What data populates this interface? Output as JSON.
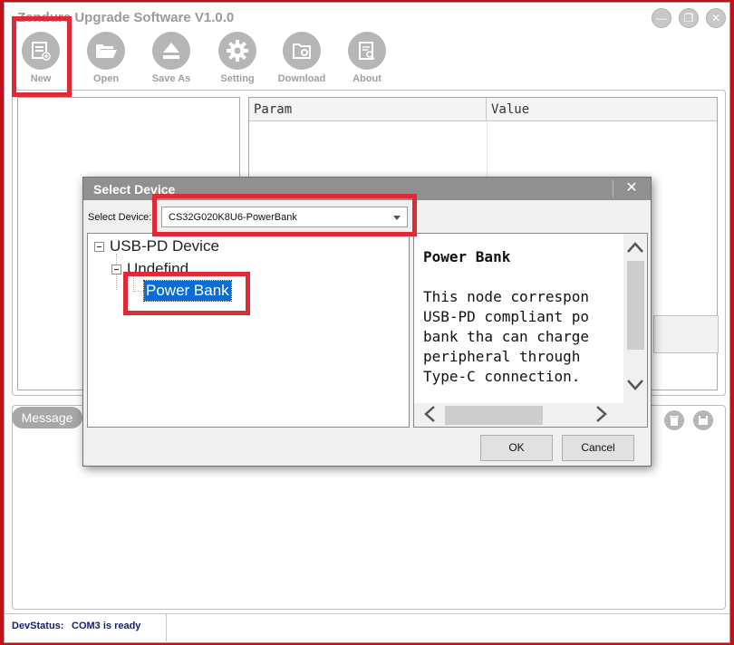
{
  "app": {
    "title": "Zendure Upgrade Software V1.0.0",
    "window_buttons": {
      "minimize": "—",
      "restore": "❐",
      "close": "✕"
    }
  },
  "toolbar": [
    {
      "label": "New",
      "icon": "new-document-icon"
    },
    {
      "label": "Open",
      "icon": "folder-open-icon"
    },
    {
      "label": "Save As",
      "icon": "eject-save-icon"
    },
    {
      "label": "Setting",
      "icon": "gear-icon"
    },
    {
      "label": "Download",
      "icon": "download-folder-icon"
    },
    {
      "label": "About",
      "icon": "about-document-icon"
    }
  ],
  "param_grid": {
    "columns": [
      "Param",
      "Value"
    ]
  },
  "message": {
    "tab_label": "Message",
    "icons": [
      "trash-icon",
      "save-icon"
    ]
  },
  "status": {
    "label": "DevStatus:",
    "value": "COM3 is ready"
  },
  "dialog": {
    "title": "Select Device",
    "close_glyph": "✕",
    "select_label": "Select Device:",
    "selected_device": "CS32G020K8U6-PowerBank",
    "tree": {
      "root": "USB-PD Device",
      "child": "Undefind",
      "leaf": "Power Bank"
    },
    "description": {
      "title": "Power Bank",
      "lines": [
        "This node correspon",
        "USB-PD compliant po",
        "bank tha can charge",
        "peripheral through",
        "Type-C connection."
      ]
    },
    "ok_label": "OK",
    "cancel_label": "Cancel"
  },
  "colors": {
    "highlight_red": "#e02a36",
    "selection_blue": "#0b6cd6",
    "status_text": "#0f1f72"
  }
}
